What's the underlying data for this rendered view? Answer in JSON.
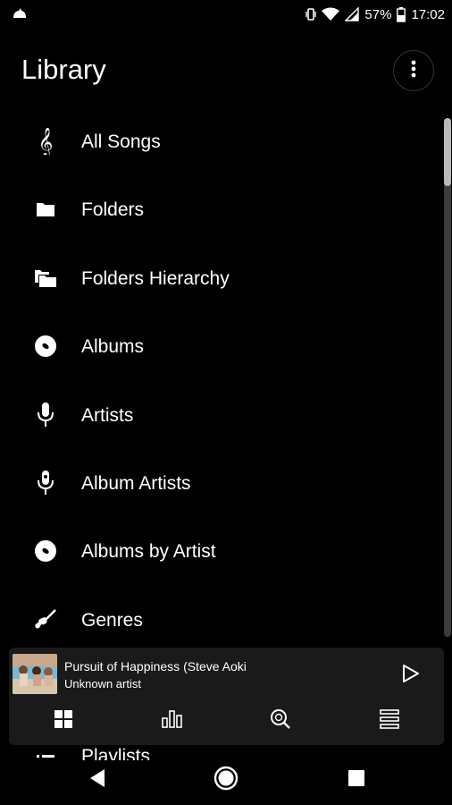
{
  "status_bar": {
    "battery": "57%",
    "time": "17:02"
  },
  "header": {
    "title": "Library"
  },
  "library": {
    "items": [
      {
        "label": "All Songs",
        "icon": "treble-clef-icon"
      },
      {
        "label": "Folders",
        "icon": "folder-icon"
      },
      {
        "label": "Folders Hierarchy",
        "icon": "folders-hierarchy-icon"
      },
      {
        "label": "Albums",
        "icon": "album-disc-icon"
      },
      {
        "label": "Artists",
        "icon": "microphone-icon"
      },
      {
        "label": "Album Artists",
        "icon": "album-artist-mic-icon"
      },
      {
        "label": "Albums by Artist",
        "icon": "album-disc-icon"
      },
      {
        "label": "Genres",
        "icon": "guitar-icon"
      }
    ],
    "peek_item": {
      "label": "Playlists",
      "icon": "playlist-icon"
    }
  },
  "player": {
    "track_title": "Pursuit of Happiness (Steve Aoki",
    "track_artist": "Unknown artist",
    "nav": [
      "grid-view-icon",
      "equalizer-bars-icon",
      "search-icon",
      "queue-list-icon"
    ]
  },
  "colors": {
    "background": "#000000",
    "player_card": "#1a1a1a",
    "text": "#ffffff"
  }
}
